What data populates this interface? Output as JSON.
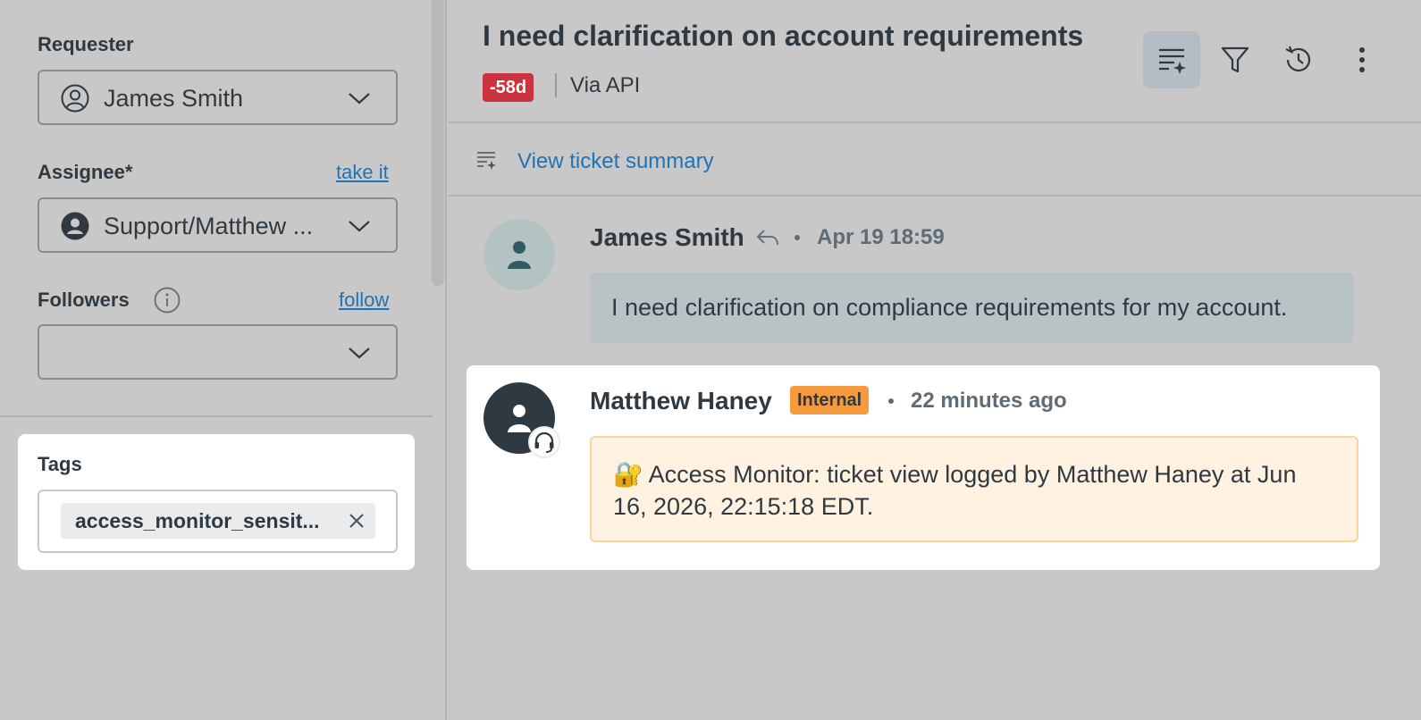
{
  "sidebar": {
    "requester": {
      "label": "Requester",
      "value": "James Smith"
    },
    "assignee": {
      "label": "Assignee*",
      "link": "take it",
      "value": "Support/Matthew ..."
    },
    "followers": {
      "label": "Followers",
      "link": "follow",
      "value": ""
    },
    "tags": {
      "label": "Tags",
      "items": [
        "access_monitor_sensit..."
      ]
    }
  },
  "header": {
    "title": "I need clarification on account requirements",
    "age_badge": "-58d",
    "via": "Via API",
    "actions": [
      "ticket-summary-icon",
      "filter-icon",
      "history-icon",
      "more-options-icon"
    ]
  },
  "summary": {
    "link": "View ticket summary"
  },
  "conversation": [
    {
      "author": "James Smith",
      "time": "Apr 19 18:59",
      "body": "I need clarification on compliance requirements for my account."
    },
    {
      "author": "Matthew Haney",
      "badge": "Internal",
      "time": "22 minutes ago",
      "body": "🔐 Access Monitor: ticket view logged by Matthew Haney at Jun 16, 2026, 22:15:18 EDT."
    }
  ],
  "colors": {
    "link": "#1f73b7",
    "age_badge": "#cc3340",
    "internal_badge": "#f79a3e",
    "note_bg": "#fff2e1",
    "customer_bubble": "#b9c2c4"
  }
}
